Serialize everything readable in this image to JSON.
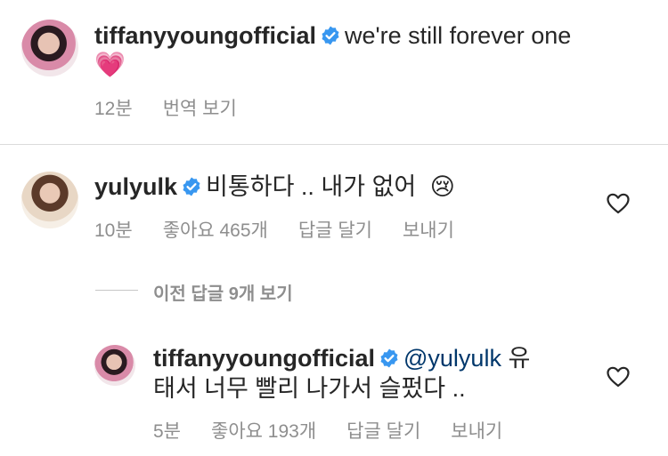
{
  "post": {
    "username": "tiffanyyoungofficial",
    "caption": "we're still forever one",
    "emoji": "💗",
    "time": "12분",
    "translate": "번역 보기"
  },
  "comment": {
    "username": "yulyulk",
    "text": "비통하다 .. 내가 없어",
    "emoji": "😢",
    "time": "10분",
    "likes": "좋아요 465개",
    "reply": "답글 달기",
    "send": "보내기"
  },
  "view_replies": "이전 답글 9개 보기",
  "reply": {
    "username": "tiffanyyoungofficial",
    "mention": "@yulyulk",
    "text_line1": "유",
    "text_line2": "태서 너무 빨리 나가서 슬펐다 ..",
    "time": "5분",
    "likes": "좋아요 193개",
    "reply": "답글 달기",
    "send": "보내기"
  },
  "colors": {
    "verified": "#3897f0",
    "mention": "#00376b",
    "meta": "#8e8e8e"
  }
}
